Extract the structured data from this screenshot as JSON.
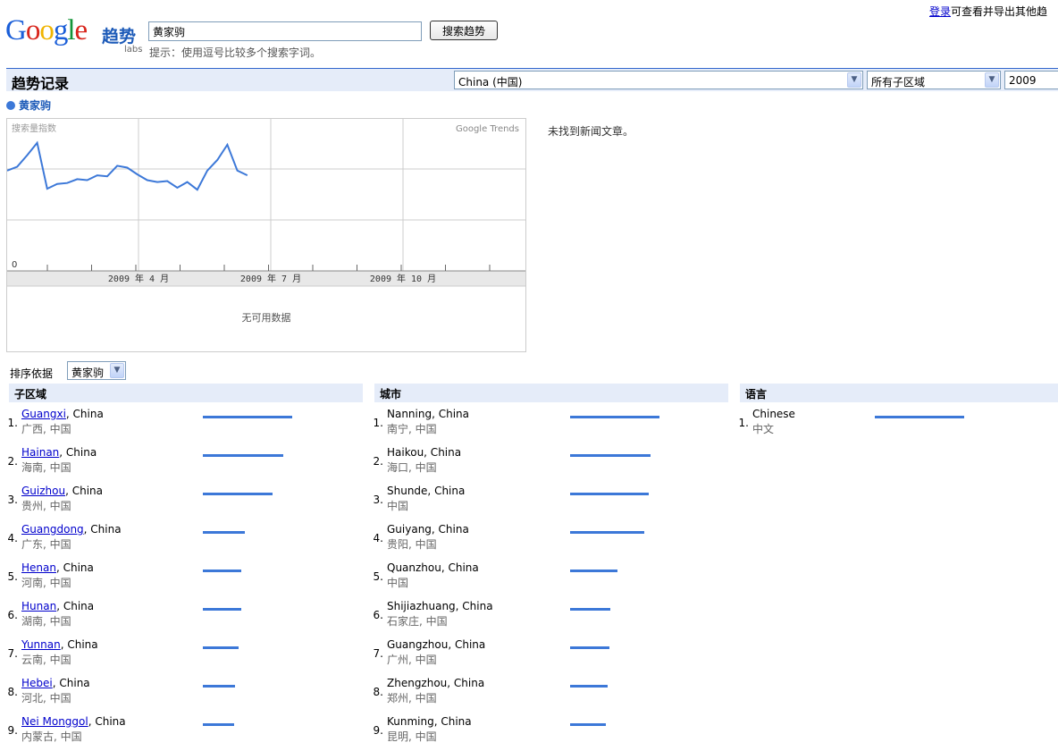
{
  "header": {
    "logo_text": "Google",
    "logo_product": "趋势",
    "logo_labs": "labs",
    "search_value": "黄家驹",
    "search_button": "搜索趋势",
    "hint": "提示：使用逗号比较多个搜索字词。",
    "login_link": "登录",
    "login_suffix": "可查看并导出其他趋"
  },
  "title_bar": {
    "title": "趋势记录",
    "region_select": "China (中国)",
    "subregion_select": "所有子区域",
    "year_select": "2009"
  },
  "legend": {
    "term": "黄家驹",
    "color": "#3c78d8"
  },
  "chart": {
    "index_label": "搜索量指数",
    "watermark": "Google Trends",
    "zero_label": "0",
    "month_labels": [
      "2009 年 4 月",
      "2009 年 7 月",
      "2009 年 10 月"
    ],
    "no_data": "无可用数据"
  },
  "chart_data": {
    "type": "line",
    "title": "",
    "xlabel": "",
    "ylabel": "搜索量指数",
    "series": [
      {
        "name": "黄家驹",
        "values": [
          0.75,
          0.79,
          0.91,
          1.04,
          0.56,
          0.61,
          0.62,
          0.66,
          0.65,
          0.7,
          0.69,
          0.8,
          0.78,
          0.71,
          0.65,
          0.63,
          0.64,
          0.57,
          0.63,
          0.55,
          0.75,
          0.86,
          1.02,
          0.75,
          0.7
        ]
      }
    ],
    "grid": true
  },
  "news": {
    "empty": "未找到新闻文章。"
  },
  "sort": {
    "label": "排序依据",
    "value": "黄家驹"
  },
  "subregions": {
    "heading": "子区域",
    "items": [
      {
        "rank": "1.",
        "name": "Guangxi",
        "country": ", China",
        "sub": "广西, 中国",
        "value": 100
      },
      {
        "rank": "2.",
        "name": "Hainan",
        "country": ", China",
        "sub": "海南, 中国",
        "value": 90
      },
      {
        "rank": "3.",
        "name": "Guizhou",
        "country": ", China",
        "sub": "贵州, 中国",
        "value": 78
      },
      {
        "rank": "4.",
        "name": "Guangdong",
        "country": ", China",
        "sub": "广东, 中国",
        "value": 47
      },
      {
        "rank": "5.",
        "name": "Henan",
        "country": ", China",
        "sub": "河南, 中国",
        "value": 43
      },
      {
        "rank": "6.",
        "name": "Hunan",
        "country": ", China",
        "sub": "湖南, 中国",
        "value": 43
      },
      {
        "rank": "7.",
        "name": "Yunnan",
        "country": ", China",
        "sub": "云南, 中国",
        "value": 40
      },
      {
        "rank": "8.",
        "name": "Hebei",
        "country": ", China",
        "sub": "河北, 中国",
        "value": 36
      },
      {
        "rank": "9.",
        "name": "Nei Monggol",
        "country": ", China",
        "sub": "内蒙古, 中国",
        "value": 35
      }
    ]
  },
  "cities": {
    "heading": "城市",
    "items": [
      {
        "rank": "1.",
        "name": "Nanning, China",
        "sub": "南宁, 中国",
        "value": 100
      },
      {
        "rank": "2.",
        "name": "Haikou, China",
        "sub": "海口, 中国",
        "value": 90
      },
      {
        "rank": "3.",
        "name": "Shunde, China",
        "sub": "中国",
        "value": 88
      },
      {
        "rank": "4.",
        "name": "Guiyang, China",
        "sub": "贵阳, 中国",
        "value": 83
      },
      {
        "rank": "5.",
        "name": "Quanzhou, China",
        "sub": "中国",
        "value": 53
      },
      {
        "rank": "6.",
        "name": "Shijiazhuang, China",
        "sub": "石家庄, 中国",
        "value": 45
      },
      {
        "rank": "7.",
        "name": "Guangzhou, China",
        "sub": "广州, 中国",
        "value": 44
      },
      {
        "rank": "8.",
        "name": "Zhengzhou, China",
        "sub": "郑州, 中国",
        "value": 42
      },
      {
        "rank": "9.",
        "name": "Kunming, China",
        "sub": "昆明, 中国",
        "value": 40
      }
    ]
  },
  "languages": {
    "heading": "语言",
    "items": [
      {
        "rank": "1.",
        "name": "Chinese",
        "sub": "中文",
        "value": 100
      }
    ]
  }
}
